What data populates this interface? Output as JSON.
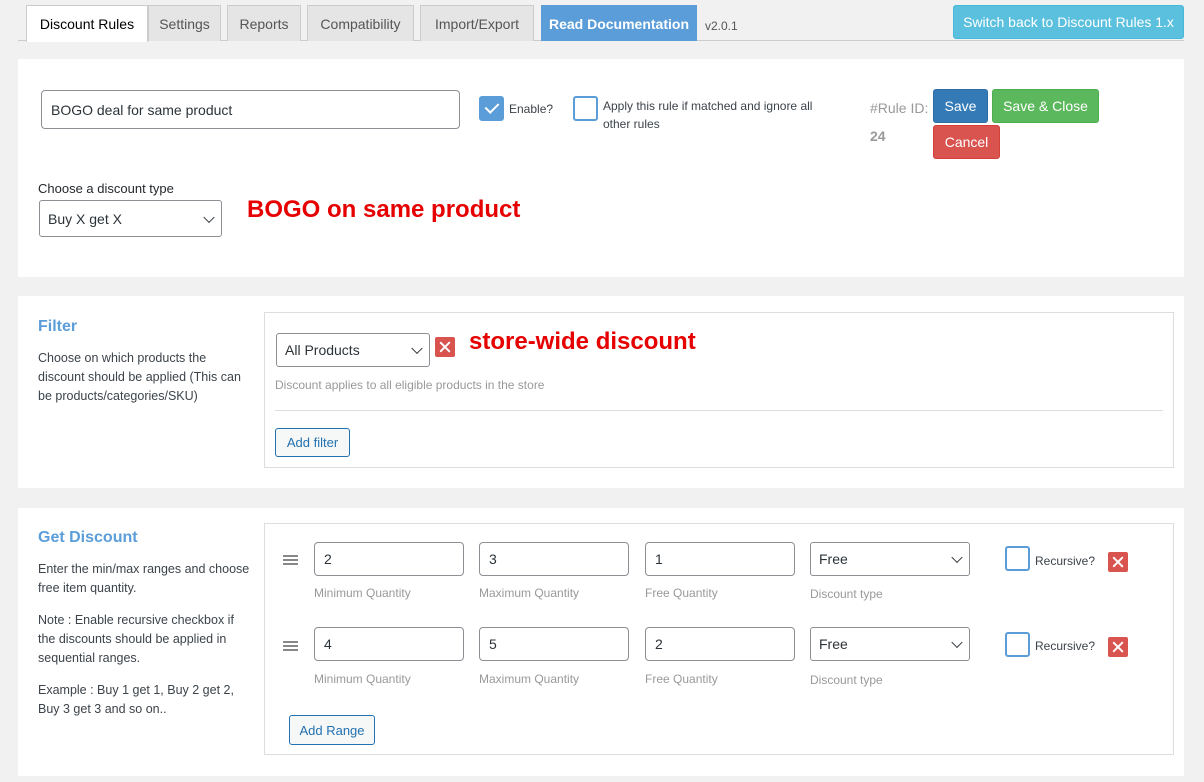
{
  "tabs": [
    {
      "label": "Discount Rules"
    },
    {
      "label": "Settings"
    },
    {
      "label": "Reports"
    },
    {
      "label": "Compatibility"
    },
    {
      "label": "Import/Export"
    },
    {
      "label": "Read Documentation"
    }
  ],
  "version": "v2.0.1",
  "switch_button": "Switch back to Discount Rules 1.x",
  "rule": {
    "title_value": "BOGO deal for same product",
    "enable_label": "Enable?",
    "enable_checked": true,
    "ignore_other_label": "Apply this rule if matched and ignore all other rules",
    "rule_id_label": "#Rule ID:",
    "rule_id": "24",
    "save": "Save",
    "save_close": "Save & Close",
    "cancel": "Cancel",
    "discount_type_label": "Choose a discount type",
    "discount_type": "Buy X get X",
    "annotation": "BOGO on same product"
  },
  "filter": {
    "title": "Filter",
    "description": "Choose on which products the discount should be applied (This can be products/categories/SKU)",
    "selected": "All Products",
    "annotation": "store-wide discount",
    "hint": "Discount applies to all eligible products in the store",
    "add_filter": "Add filter"
  },
  "get_discount": {
    "title": "Get Discount",
    "description": "Enter the min/max ranges and choose free item quantity.",
    "note": "Note : Enable recursive checkbox if the discounts should be applied in sequential ranges.",
    "example": "Example : Buy 1 get 1, Buy 2 get 2, Buy 3 get 3 and so on..",
    "labels": {
      "min": "Minimum Quantity",
      "max": "Maximum Quantity",
      "free": "Free Quantity",
      "type": "Discount type",
      "recursive": "Recursive?"
    },
    "ranges": [
      {
        "min": "2",
        "max": "3",
        "free": "1",
        "type": "Free",
        "recursive": false
      },
      {
        "min": "4",
        "max": "5",
        "free": "2",
        "type": "Free",
        "recursive": false
      }
    ],
    "add_range": "Add Range"
  },
  "colors": {
    "accent": "#5b9dd9",
    "save": "#337ab7",
    "save_close": "#5cb85c",
    "cancel": "#d9534f",
    "annotation": "#e60000"
  }
}
